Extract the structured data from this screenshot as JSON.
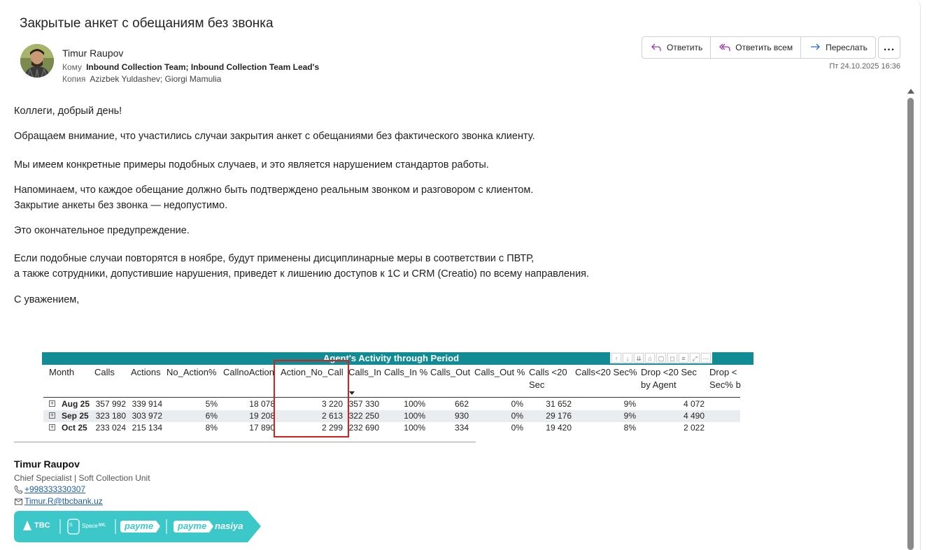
{
  "email": {
    "subject": "Закрытые анкет с обещаниям без звонка",
    "sender": "Timur Raupov",
    "to_label": "Кому",
    "to_names": "Inbound Collection Team; Inbound Collection Team Lead's",
    "cc_label": "Копия",
    "cc_names": "Azizbek Yuldashev; Giorgi Mamulia",
    "date": "Пт 24.10.2025 16:36",
    "actions": {
      "reply": "Ответить",
      "reply_all": "Ответить всем",
      "forward": "Переслать",
      "more": "..."
    }
  },
  "body": {
    "greeting": "Коллеги, добрый день!",
    "p1": "Обращаем внимание, что участились случаи закрытия анкет с обещаниями без фактического звонка клиенту.",
    "p2": "Мы имеем конкретные примеры подобных случаев, и это является нарушением стандартов работы.",
    "p3a": "Напоминаем, что каждое обещание должно быть подтверждено реальным звонком и разговором с клиентом.",
    "p3b": "Закрытие анкеты без звонка — недопустимо.",
    "p4": "Это окончательное предупреждение.",
    "p5a": "Если подобные случаи повторятся в ноябре, будут применены дисциплинарные меры в соответствии с ПВТР,",
    "p5b": "а также сотрудники, допустившие нарушения, приведет к лишению доступов к 1С и CRM (Creatio) по всему направления.",
    "closing": "С уважением,"
  },
  "report": {
    "title": "Agent's Activity through Period",
    "headers": [
      {
        "l1": "Month",
        "l2": ""
      },
      {
        "l1": "Calls",
        "l2": ""
      },
      {
        "l1": "Actions",
        "l2": ""
      },
      {
        "l1": "No_Action%",
        "l2": ""
      },
      {
        "l1": "CallnoAction",
        "l2": ""
      },
      {
        "l1": "Action_No_Call",
        "l2": ""
      },
      {
        "l1": "Calls_In",
        "l2": ""
      },
      {
        "l1": "Calls_In %",
        "l2": ""
      },
      {
        "l1": "Calls_Out",
        "l2": ""
      },
      {
        "l1": "Calls_Out %",
        "l2": ""
      },
      {
        "l1": "Calls <20",
        "l2": "Sec"
      },
      {
        "l1": "Calls<20 Sec%",
        "l2": ""
      },
      {
        "l1": "Drop <20 Sec",
        "l2": "by Agent"
      },
      {
        "l1": "Drop <",
        "l2": "Sec% b"
      }
    ],
    "rows": [
      {
        "month": "Aug 25",
        "calls": "357 992",
        "actions": "339 914",
        "no_action_pct": "5%",
        "callnoaction": "18 078",
        "action_no_call": "3 220",
        "calls_in": "357 330",
        "calls_in_pct": "100%",
        "calls_out": "662",
        "calls_out_pct": "0%",
        "calls_20": "31 652",
        "calls_20_pct": "9%",
        "drop_20": "4 072"
      },
      {
        "month": "Sep 25",
        "calls": "323 180",
        "actions": "303 972",
        "no_action_pct": "6%",
        "callnoaction": "19 208",
        "action_no_call": "2 613",
        "calls_in": "322 250",
        "calls_in_pct": "100%",
        "calls_out": "930",
        "calls_out_pct": "0%",
        "calls_20": "29 176",
        "calls_20_pct": "9%",
        "drop_20": "4 490"
      },
      {
        "month": "Oct 25",
        "calls": "233 024",
        "actions": "215 134",
        "no_action_pct": "8%",
        "callnoaction": "17 890",
        "action_no_call": "2 299",
        "calls_in": "232 690",
        "calls_in_pct": "100%",
        "calls_out": "334",
        "calls_out_pct": "0%",
        "calls_20": "19 420",
        "calls_20_pct": "8%",
        "drop_20": "2 022"
      }
    ]
  },
  "signature": {
    "name": "Timur Raupov",
    "title": "Chief Specialist | Soft Collection Unit",
    "phone": "+998333330307",
    "email": "Timur.R@tbcbank.uz",
    "banner": {
      "tbc": "TBC",
      "space": "Space",
      "space_suffix": "Int.",
      "payme1": "payme",
      "payme2": "payme",
      "nasiya": "nasiya",
      "color": "#3cc8c8"
    }
  },
  "colors": {
    "report_header": "#118c95",
    "highlight_box": "#d81e1e",
    "link": "#1f5ea8"
  }
}
